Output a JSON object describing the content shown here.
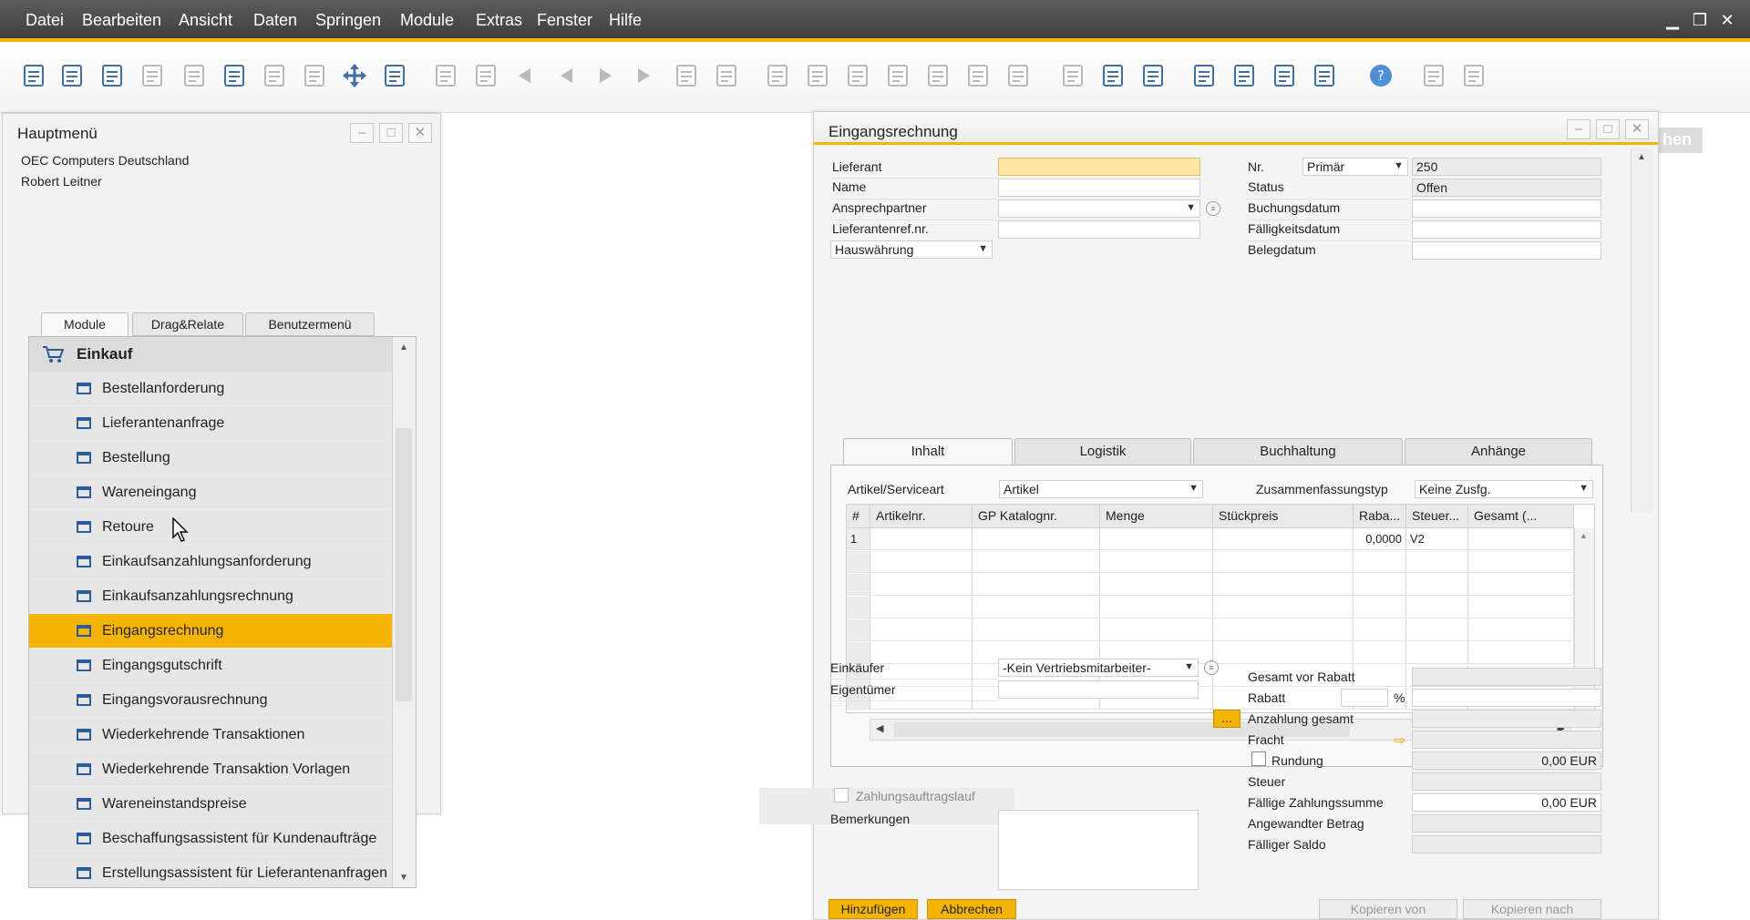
{
  "menubar": {
    "items": [
      "Datei",
      "Bearbeiten",
      "Ansicht",
      "Daten",
      "Springen",
      "Module",
      "Extras",
      "Fenster",
      "Hilfe"
    ]
  },
  "colors": {
    "accent": "#f5b400",
    "menubar": "#4a4a4a",
    "icon_blue": "#2a5b9c"
  },
  "toolbar": {
    "icons": [
      "print-preview-icon",
      "print-icon",
      "email-icon",
      "sms-icon",
      "fax-icon",
      "excel-icon",
      "word-icon",
      "pdf-icon",
      "move-icon",
      "lock-icon",
      "find-icon",
      "add-icon",
      "first-record-icon",
      "previous-record-icon",
      "next-record-icon",
      "last-record-icon",
      "filter-icon",
      "sort-icon",
      "base-document-icon",
      "target-document-icon",
      "journal-icon",
      "payment-icon",
      "gross-profit-icon",
      "volume-icon",
      "references-icon",
      "edit-icon",
      "new-document-icon",
      "settings-icon",
      "activity-icon",
      "message-icon",
      "calendar-icon",
      "flow-icon",
      "help-icon",
      "layout-icon",
      "form-icon"
    ]
  },
  "main_menu": {
    "title": "Hauptmenü",
    "company": "OEC Computers Deutschland",
    "user": "Robert Leitner",
    "tabs": [
      "Module",
      "Drag&Relate",
      "Benutzermenü"
    ],
    "header": "Einkauf",
    "items": [
      "Bestellanforderung",
      "Lieferantenanfrage",
      "Bestellung",
      "Wareneingang",
      "Retoure",
      "Einkaufsanzahlungsanforderung",
      "Einkaufsanzahlungsrechnung",
      "Eingangsrechnung",
      "Eingangsgutschrift",
      "Eingangsvorausrechnung",
      "Wiederkehrende Transaktionen",
      "Wiederkehrende Transaktion Vorlagen",
      "Wareneinstandspreise",
      "Beschaffungsassistent für Kundenaufträge",
      "Erstellungsassistent für Lieferantenanfragen"
    ],
    "selected": "Eingangsrechnung"
  },
  "behind_button": "hen",
  "invoice": {
    "title": "Eingangsrechnung",
    "left_labels": {
      "lieferant": "Lieferant",
      "name": "Name",
      "ansprechpartner": "Ansprechpartner",
      "lieferantenref": "Lieferantenref.nr.",
      "currency": "Hauswährung"
    },
    "right_labels": {
      "nr": "Nr.",
      "status": "Status",
      "buchungsdatum": "Buchungsdatum",
      "faelligkeitsdatum": "Fälligkeitsdatum",
      "belegdatum": "Belegdatum"
    },
    "series": "Primär",
    "number": "250",
    "status": "Offen",
    "tabs": [
      "Inhalt",
      "Logistik",
      "Buchhaltung",
      "Anhänge"
    ],
    "item_type_label": "Artikel/Serviceart",
    "item_type": "Artikel",
    "summary_label": "Zusammenfassungstyp",
    "summary": "Keine Zusfg.",
    "grid_headers": [
      "#",
      "Artikelnr.",
      "GP Katalognr.",
      "Menge",
      "Stückpreis",
      "Raba...",
      "Steuer...",
      "Gesamt (..."
    ],
    "grid_rows": [
      [
        "1",
        "",
        "",
        "",
        "",
        "0,0000",
        "V2",
        ""
      ]
    ],
    "buyer_label": "Einkäufer",
    "buyer": "-Kein Vertriebsmitarbeiter-",
    "owner_label": "Eigentümer",
    "payment_run_label": "Zahlungsauftragslauf",
    "remarks_label": "Bemerkungen",
    "totals": {
      "before_discount": "Gesamt vor Rabatt",
      "discount": "Rabatt",
      "percent": "%",
      "down_payment": "Anzahlung gesamt",
      "freight": "Fracht",
      "rounding": "Rundung",
      "rounding_value": "0,00 EUR",
      "tax": "Steuer",
      "total_due": "Fällige Zahlungssumme",
      "total_due_value": "0,00 EUR",
      "applied": "Angewandter Betrag",
      "balance_due": "Fälliger Saldo"
    },
    "dots_button": "...",
    "buttons": {
      "add": "Hinzufügen",
      "cancel": "Abbrechen",
      "copy_from": "Kopieren von",
      "copy_to": "Kopieren nach"
    }
  }
}
